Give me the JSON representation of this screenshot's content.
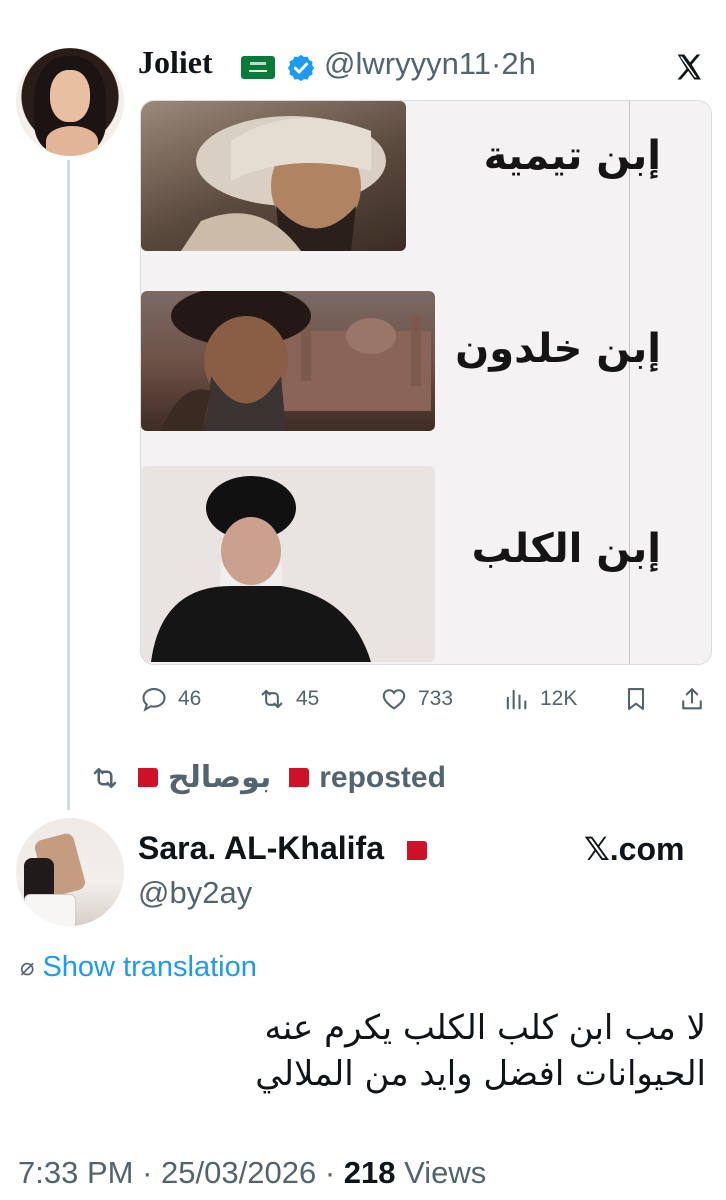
{
  "quoted_tweet": {
    "display_name": "Joliet",
    "handle": "@lwryyyn11",
    "separator": "·",
    "age": "2h",
    "meme_labels": [
      "إبن تيمية",
      "إبن خلدون",
      "إبن الكلب"
    ],
    "actions": {
      "replies": "46",
      "reposts": "45",
      "likes": "733",
      "views": "12K"
    }
  },
  "repost_banner": {
    "name": "بوصالح",
    "action": "reposted"
  },
  "main_tweet": {
    "display_name": "Sara. AL-Khalifa",
    "handle": "@by2ay",
    "brand": "𝕏.com",
    "translate_label": "Show translation",
    "text_line1": "لا مب ابن كلب الكلب يكرم عنه",
    "text_line2": "الحيوانات افضل وايد من الملالي",
    "time": "7:33 PM",
    "dot": "·",
    "date": "25/03/2026",
    "views_count": "218",
    "views_label": "Views"
  },
  "colors": {
    "accent": "#1d9bf0",
    "muted": "#536471",
    "verified": "#1d9bf0"
  },
  "icons": [
    "verified-badge-icon",
    "x-logo-icon",
    "reply-icon",
    "repost-icon",
    "like-icon",
    "views-icon",
    "bookmark-icon",
    "share-icon",
    "globe-icon"
  ]
}
